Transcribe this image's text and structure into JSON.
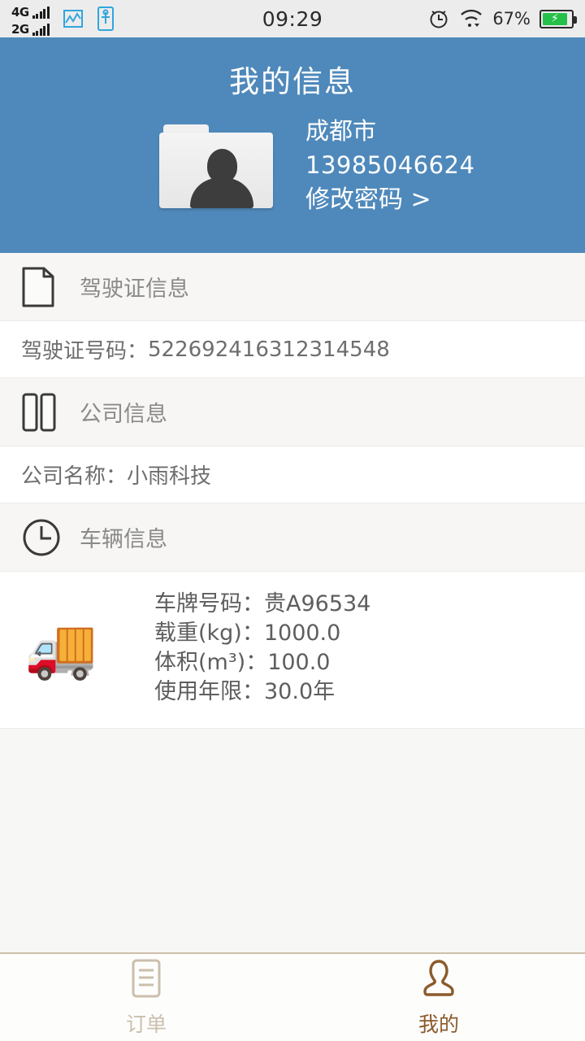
{
  "statusbar": {
    "network_primary": "4G",
    "network_secondary": "2G",
    "time": "09:29",
    "battery_percent": "67%",
    "icons": [
      "signal-4g-icon",
      "signal-2g-icon",
      "data-monitor-icon",
      "usb-icon",
      "alarm-clock-icon",
      "wifi-icon",
      "battery-charging-icon"
    ]
  },
  "header": {
    "title": "我的信息",
    "city": "成都市",
    "phone": "13985046624",
    "change_password_link": "修改密码 >",
    "background_color": "#4f89bb"
  },
  "sections": [
    {
      "icon": "document-icon",
      "title": "驾驶证信息",
      "rows": [
        {
          "label": "驾驶证号码：",
          "value": "522692416312314548"
        }
      ]
    },
    {
      "icon": "company-icon",
      "title": "公司信息",
      "rows": [
        {
          "label": "公司名称：",
          "value": " 小雨科技"
        }
      ]
    },
    {
      "icon": "clock-icon",
      "title": "车辆信息",
      "vehicle": {
        "icon": "truck-icon",
        "lines": [
          "车牌号码：贵A96534",
          "载重(kg)：1000.0",
          "体积(m³)：100.0",
          "使用年限：30.0年"
        ]
      }
    }
  ],
  "tabbar": {
    "active_color": "#8b5a2b",
    "inactive_color": "#cbbfad",
    "tabs": [
      {
        "icon": "order-list-icon",
        "label": "订单",
        "active": false
      },
      {
        "icon": "person-icon",
        "label": "我的",
        "active": true
      }
    ]
  }
}
